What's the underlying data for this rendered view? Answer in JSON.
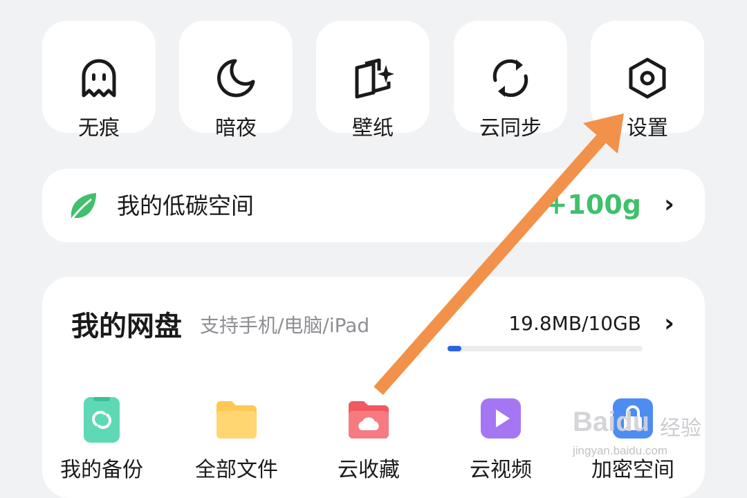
{
  "quick_actions": [
    {
      "label": "无痕",
      "icon": "ghost-icon"
    },
    {
      "label": "暗夜",
      "icon": "moon-icon"
    },
    {
      "label": "壁纸",
      "icon": "wallpaper-sparkle-icon"
    },
    {
      "label": "云同步",
      "icon": "sync-icon"
    },
    {
      "label": "设置",
      "icon": "settings-hexagon-icon"
    }
  ],
  "carbon": {
    "title": "我的低碳空间",
    "value": "+100g",
    "icon": "leaf-icon",
    "accent": "#3fc06b"
  },
  "cloud_disk": {
    "title": "我的网盘",
    "subtitle": "支持手机/电脑/iPad",
    "usage": "19.8MB/10GB",
    "usage_fraction": 0.002,
    "bar_color": "#2b64e3",
    "items": [
      {
        "label": "我的备份",
        "icon": "phone-backup-icon",
        "color": "#4fd3b0"
      },
      {
        "label": "全部文件",
        "icon": "folder-icon",
        "color": "#ffc44d"
      },
      {
        "label": "云收藏",
        "icon": "cloud-folder-icon",
        "color": "#f56b72"
      },
      {
        "label": "云视频",
        "icon": "video-play-icon",
        "color": "#9b6cf0"
      },
      {
        "label": "加密空间",
        "icon": "lock-vault-icon",
        "color": "#4a8cf0"
      }
    ]
  },
  "annotation": {
    "arrow_color": "#f2924a"
  },
  "watermark": {
    "brand": "Baidu",
    "cn": "经验",
    "url": "jingyan.baidu.com"
  }
}
